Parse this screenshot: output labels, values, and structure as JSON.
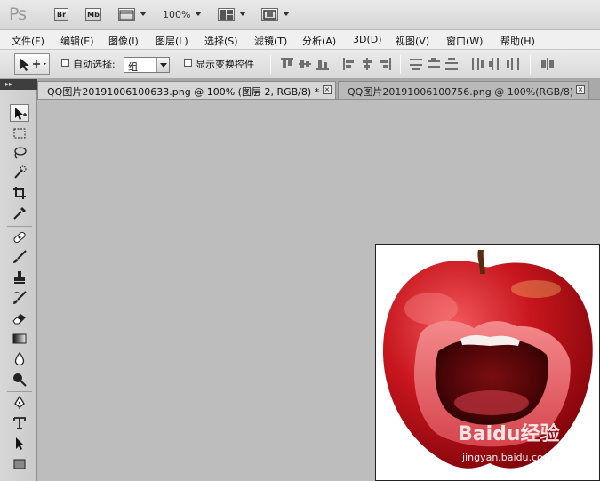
{
  "appbar": {
    "logo": "Ps",
    "bridge": "Br",
    "minibridge": "Mb",
    "zoom": "100%"
  },
  "menu": [
    "文件(F)",
    "编辑(E)",
    "图像(I)",
    "图层(L)",
    "选择(S)",
    "滤镜(T)",
    "分析(A)",
    "3D(D)",
    "视图(V)",
    "窗口(W)",
    "帮助(H)"
  ],
  "options": {
    "auto_select_label": "自动选择:",
    "auto_select_checked": false,
    "auto_select_target": "组",
    "show_transform_label": "显示变换控件",
    "show_transform_checked": false
  },
  "tabs": [
    {
      "title": "QQ图片20191006100633.png @ 100% (图层 2, RGB/8) *",
      "active": true
    },
    {
      "title": "QQ图片20191006100756.png @ 100%(RGB/8)",
      "active": false
    }
  ],
  "panel_toggle": "▸▸",
  "close_glyph": "×",
  "image": {
    "watermark": "Baidu经验",
    "watermark_url": "jingyan.baidu.com"
  },
  "tools": [
    "move-tool",
    "marquee-tool",
    "lasso-tool",
    "quick-select-tool",
    "crop-tool",
    "eyedropper-tool",
    "healing-brush-tool",
    "brush-tool",
    "clone-stamp-tool",
    "history-brush-tool",
    "eraser-tool",
    "gradient-tool",
    "blur-tool",
    "dodge-tool",
    "pen-tool",
    "type-tool",
    "path-select-tool",
    "shape-tool"
  ],
  "colors": {
    "apple_red": "#c0141c",
    "lip_pink": "#e0565e",
    "workspace": "#bdbdbd"
  }
}
